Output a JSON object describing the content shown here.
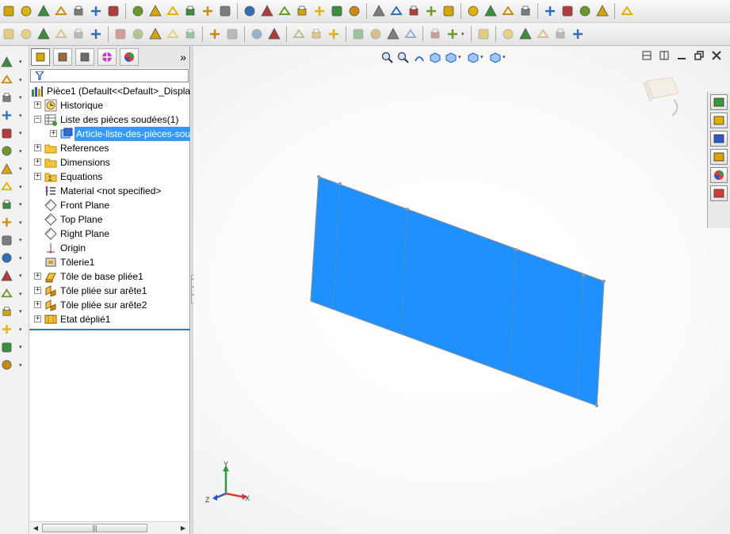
{
  "toolbar_top": {
    "groups": [
      [
        "sketch-icon",
        "smart-dimension-icon",
        "convert-entities-icon",
        "trim-icon",
        "mirror-entities-icon",
        "move-entities-icon",
        "relations-icon"
      ],
      [
        "3d-sketch-icon",
        "base-flange-icon",
        "edge-flange-icon",
        "miter-flange-icon",
        "hem-icon",
        "sketched-bend-icon"
      ],
      [
        "insert-bends-icon",
        "rip-icon",
        "unfold-icon",
        "fold-icon",
        "flatten-icon",
        "no-bends-icon",
        "jog-icon"
      ],
      [
        "extruded-boss-icon",
        "revolve-icon",
        "loft-icon",
        "forming-tool-icon",
        "vent-icon"
      ],
      [
        "weld-structure-icon",
        "trim-extend-icon",
        "gusset-icon",
        "end-cap-icon"
      ],
      [
        "measure-icon",
        "reference-line-icon",
        "point-icon",
        "image-icon"
      ],
      [
        "run-icon"
      ]
    ]
  },
  "toolbar_second": {
    "groups": [
      [
        "open-icon",
        "save-icon",
        "print-icon",
        "undo-icon",
        "rebuild-icon",
        "options-icon"
      ],
      [
        "line-icon",
        "rectangle-icon",
        "circle-icon",
        "arc-icon",
        "spline-icon"
      ],
      [
        "offset-icon",
        "pattern-icon"
      ],
      [
        "section-view-icon",
        "measure-icon"
      ],
      [
        "hide-show-icon",
        "spell-check-icon",
        "edit-appearance-icon"
      ],
      [
        "text-icon",
        "zoom-icon",
        "pan-icon",
        "shaded-icon"
      ],
      [
        "view-orientation-icon",
        "standard-views-icon"
      ],
      [
        "table-icon"
      ],
      [
        "plane-icon",
        "axis-icon",
        "coordinate-icon",
        "mate-icon",
        "sensor-icon"
      ]
    ]
  },
  "command_bar": {
    "icons": [
      "smart-dimension-icon",
      "dimension-icon",
      "line-icon",
      "rectangle-icon",
      "slot-icon",
      "circle-icon",
      "arc-icon",
      "spline-icon",
      "fillet-icon",
      "polygon-icon",
      "point-icon",
      "trim-icon",
      "offset-icon",
      "construction-geometry-icon",
      "warning-icon",
      "linear-pattern-icon",
      "move-entities-icon",
      "repair-sketch-icon"
    ]
  },
  "feature_manager": {
    "tabs": [
      "feature-manager-tab",
      "property-manager-tab",
      "configuration-manager-tab",
      "dimxpert-tab",
      "display-manager-tab"
    ],
    "more_label": "»",
    "items": [
      {
        "label": "Pièce1  (Default<<Default>_Displa",
        "icon": "part-icon",
        "expander": "",
        "indent": 0,
        "selected": false
      },
      {
        "label": "Historique",
        "icon": "history-icon",
        "expander": "+",
        "indent": 1,
        "selected": false
      },
      {
        "label": "Liste des pièces soudées(1)",
        "icon": "cut-list-icon",
        "expander": "−",
        "indent": 1,
        "selected": false
      },
      {
        "label": "Article-liste-des-pièces-sou",
        "icon": "cut-list-item-icon",
        "expander": "+",
        "indent": 2,
        "selected": true
      },
      {
        "label": "References",
        "icon": "folder-icon",
        "expander": "+",
        "indent": 1,
        "selected": false
      },
      {
        "label": "Dimensions",
        "icon": "folder-icon",
        "expander": "+",
        "indent": 1,
        "selected": false
      },
      {
        "label": "Equations",
        "icon": "equations-icon",
        "expander": "+",
        "indent": 1,
        "selected": false
      },
      {
        "label": "Material <not specified>",
        "icon": "material-icon",
        "expander": "",
        "indent": 1,
        "selected": false
      },
      {
        "label": "Front Plane",
        "icon": "plane-icon",
        "expander": "",
        "indent": 1,
        "selected": false
      },
      {
        "label": "Top Plane",
        "icon": "plane-icon",
        "expander": "",
        "indent": 1,
        "selected": false
      },
      {
        "label": "Right Plane",
        "icon": "plane-icon",
        "expander": "",
        "indent": 1,
        "selected": false
      },
      {
        "label": "Origin",
        "icon": "origin-icon",
        "expander": "",
        "indent": 1,
        "selected": false
      },
      {
        "label": "Tôlerie1",
        "icon": "sheet-metal-icon",
        "expander": "",
        "indent": 1,
        "selected": false
      },
      {
        "label": "Tôle de base pliée1",
        "icon": "base-flange-icon",
        "expander": "+",
        "indent": 1,
        "selected": false
      },
      {
        "label": "Tôle pliée sur arête1",
        "icon": "edge-flange-icon",
        "expander": "+",
        "indent": 1,
        "selected": false
      },
      {
        "label": "Tôle pliée sur arête2",
        "icon": "edge-flange-icon",
        "expander": "+",
        "indent": 1,
        "selected": false
      },
      {
        "label": "Etat déplié1",
        "icon": "flat-pattern-icon",
        "expander": "+",
        "indent": 1,
        "selected": false
      }
    ],
    "scrollbar_thumb_label": "|||"
  },
  "viewport": {
    "hud_icons": [
      "zoom-to-fit-icon",
      "zoom-area-icon",
      "previous-view-icon",
      "section-view-icon",
      "view-orientation-icon",
      "display-style-icon",
      "hide-show-items-icon"
    ],
    "window_buttons": [
      "tile-horizontal-icon",
      "tile-vertical-icon",
      "minimize-icon",
      "restore-icon",
      "close-icon"
    ],
    "part_color": "#1e90ff",
    "triad_labels": {
      "y": "Y",
      "x": "X",
      "z": "Z"
    }
  },
  "task_pane": {
    "icons": [
      "solidworks-resources-icon",
      "design-library-icon",
      "file-explorer-icon",
      "view-palette-icon",
      "appearances-icon",
      "custom-properties-icon"
    ]
  }
}
